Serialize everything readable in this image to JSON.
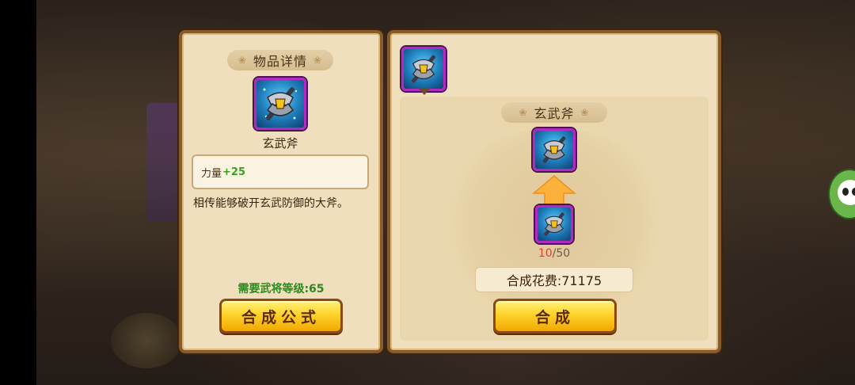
{
  "left_panel": {
    "title": "物品详情",
    "item_name": "玄武斧",
    "stat_label": "力量",
    "stat_value": "+25",
    "description": "相传能够破开玄武防御的大斧。",
    "requirement": "需要武将等级:65",
    "formula_button": "合成公式"
  },
  "right_panel": {
    "target_name": "玄武斧",
    "material_count_have": "10",
    "material_count_need": "/50",
    "cost_text": "合成花费:71175",
    "compose_button": "合成"
  },
  "icons": {
    "item": "axe-icon",
    "arrow": "up-arrow-icon",
    "avatar": "panda-avatar-icon"
  },
  "colors": {
    "panel_bg": "#efdfbd",
    "panel_border": "#8a5a28",
    "rare_frame": "#b02cc0",
    "stat_green": "#3aa020",
    "count_red": "#e0402a",
    "button_gold": "#ffd22a"
  }
}
